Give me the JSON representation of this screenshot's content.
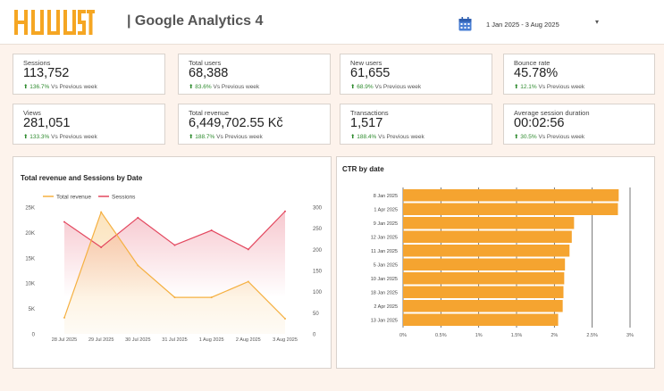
{
  "header": {
    "logo_text": "HUUUST",
    "title": "| Google Analytics 4",
    "date_range": "1 Jan 2025 - 3 Aug 2025",
    "date_caret": "▾"
  },
  "kpis": [
    {
      "label": "Sessions",
      "value": "113,752",
      "delta": "136.7%",
      "delta_suffix": "Vs Previous week"
    },
    {
      "label": "Total users",
      "value": "68,388",
      "delta": "83.6%",
      "delta_suffix": "Vs Previous week"
    },
    {
      "label": "New users",
      "value": "61,655",
      "delta": "68.9%",
      "delta_suffix": "Vs Previous week"
    },
    {
      "label": "Bounce rate",
      "value": "45.78%",
      "delta": "12.1%",
      "delta_suffix": "Vs Previous week"
    },
    {
      "label": "Views",
      "value": "281,051",
      "delta": "133.3%",
      "delta_suffix": "Vs Previous week"
    },
    {
      "label": "Total revenue",
      "value": "6,449,702.55 Kč",
      "delta": "188.7%",
      "delta_suffix": "Vs Previous week"
    },
    {
      "label": "Transactions",
      "value": "1,517",
      "delta": "188.4%",
      "delta_suffix": "Vs Previous week"
    },
    {
      "label": "Average session duration",
      "value": "00:02:56",
      "delta": "30.5%",
      "delta_suffix": "Vs Previous week"
    }
  ],
  "colors": {
    "accent": "#f5a623",
    "revenue": "#f5b041",
    "sessions": "#e3485f",
    "bar": "#f5a430",
    "positive": "#2e8b2e"
  },
  "chart_data": [
    {
      "type": "line",
      "title": "Total revenue and Sessions by Date",
      "categories": [
        "28 Jul 2025",
        "29 Jul 2025",
        "30 Jul 2025",
        "31 Jul 2025",
        "1 Aug 2025",
        "2 Aug 2025",
        "3 Aug 2025"
      ],
      "series": [
        {
          "name": "Total revenue",
          "axis": "left",
          "values": [
            3200,
            24000,
            13500,
            7200,
            7200,
            10300,
            3000
          ]
        },
        {
          "name": "Sessions",
          "axis": "right",
          "values": [
            265,
            205,
            275,
            210,
            245,
            200,
            290
          ]
        }
      ],
      "y_left": {
        "ticks": [
          0,
          5000,
          10000,
          15000,
          20000,
          25000
        ],
        "tick_labels": [
          "0",
          "5K",
          "10K",
          "15K",
          "20K",
          "25K"
        ],
        "range": [
          0,
          25000
        ]
      },
      "y_right": {
        "ticks": [
          0,
          50,
          100,
          150,
          200,
          250,
          300
        ],
        "tick_labels": [
          "0",
          "50",
          "100",
          "150",
          "200",
          "250",
          "300"
        ],
        "range": [
          0,
          300
        ]
      },
      "legend": "top-left"
    },
    {
      "type": "bar",
      "orientation": "horizontal",
      "title": "CTR by date",
      "categories": [
        "8 Jan 2025",
        "1 Apr 2025",
        "9 Jan 2025",
        "12 Jan 2025",
        "11 Jan 2025",
        "5 Jan 2025",
        "10 Jan 2025",
        "18 Jan 2025",
        "2 Apr 2025",
        "13 Jan 2025"
      ],
      "values": [
        2.85,
        2.84,
        2.26,
        2.23,
        2.2,
        2.14,
        2.13,
        2.12,
        2.11,
        2.05
      ],
      "x_ticks": [
        0,
        0.5,
        1,
        1.5,
        2,
        2.5,
        3
      ],
      "x_tick_labels": [
        "0%",
        "0.5%",
        "1%",
        "1.5%",
        "2%",
        "2.5%",
        "3%"
      ],
      "x_range": [
        0,
        3
      ],
      "grid": true
    }
  ]
}
